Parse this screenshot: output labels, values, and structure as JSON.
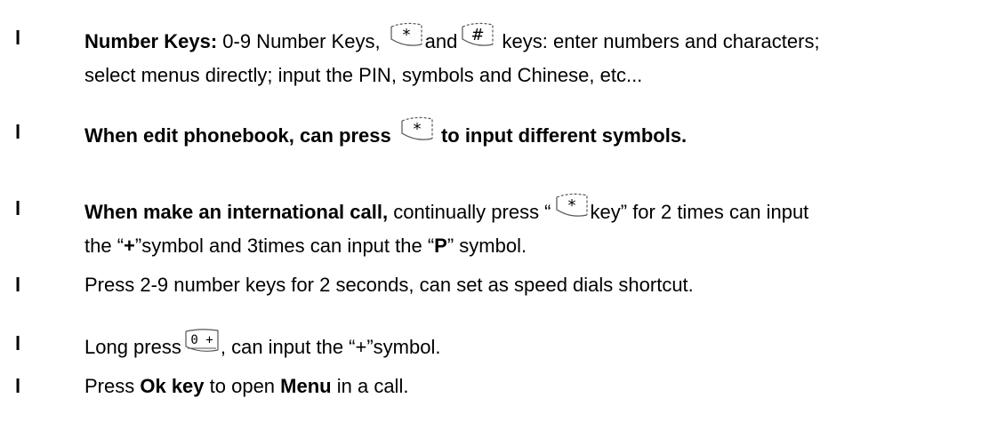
{
  "bullet_glyph": "l",
  "items": [
    {
      "lines": [
        {
          "a": "Number Keys:",
          "b": " 0-9 Number Keys, ",
          "c": "and",
          "d": " keys: enter numbers and characters;"
        },
        {
          "a": "select menus directly; input the PIN, symbols and Chinese, etc..."
        }
      ]
    },
    {
      "lines": [
        {
          "a": "When edit phonebook, can press ",
          "b": " to input different symbols."
        }
      ]
    },
    {
      "lines": [
        {
          "a": "When make an international call,",
          "b": " continually press “",
          "c": "key” for 2 times can input"
        },
        {
          "a": "the “",
          "b": "+",
          "c": "”symbol and 3times can input the “",
          "d": "P",
          "e": "” symbol."
        }
      ]
    },
    {
      "lines": [
        {
          "a": "Press 2-9 number keys for 2 seconds, can set as speed dials shortcut."
        }
      ]
    },
    {
      "lines": [
        {
          "a": "Long press",
          "b": ", can input the “+”symbol."
        }
      ]
    },
    {
      "lines": [
        {
          "a": "Press ",
          "b": "Ok key",
          "c": " to open ",
          "d": "Menu",
          "e": " in a call."
        }
      ]
    }
  ],
  "icons": {
    "star_key": "star-key-icon",
    "hash_key": "hash-key-icon",
    "zero_plus_key": "zero-plus-key-icon"
  },
  "key_labels": {
    "star": "*",
    "hash": "#",
    "zero_plus": "0 +"
  }
}
